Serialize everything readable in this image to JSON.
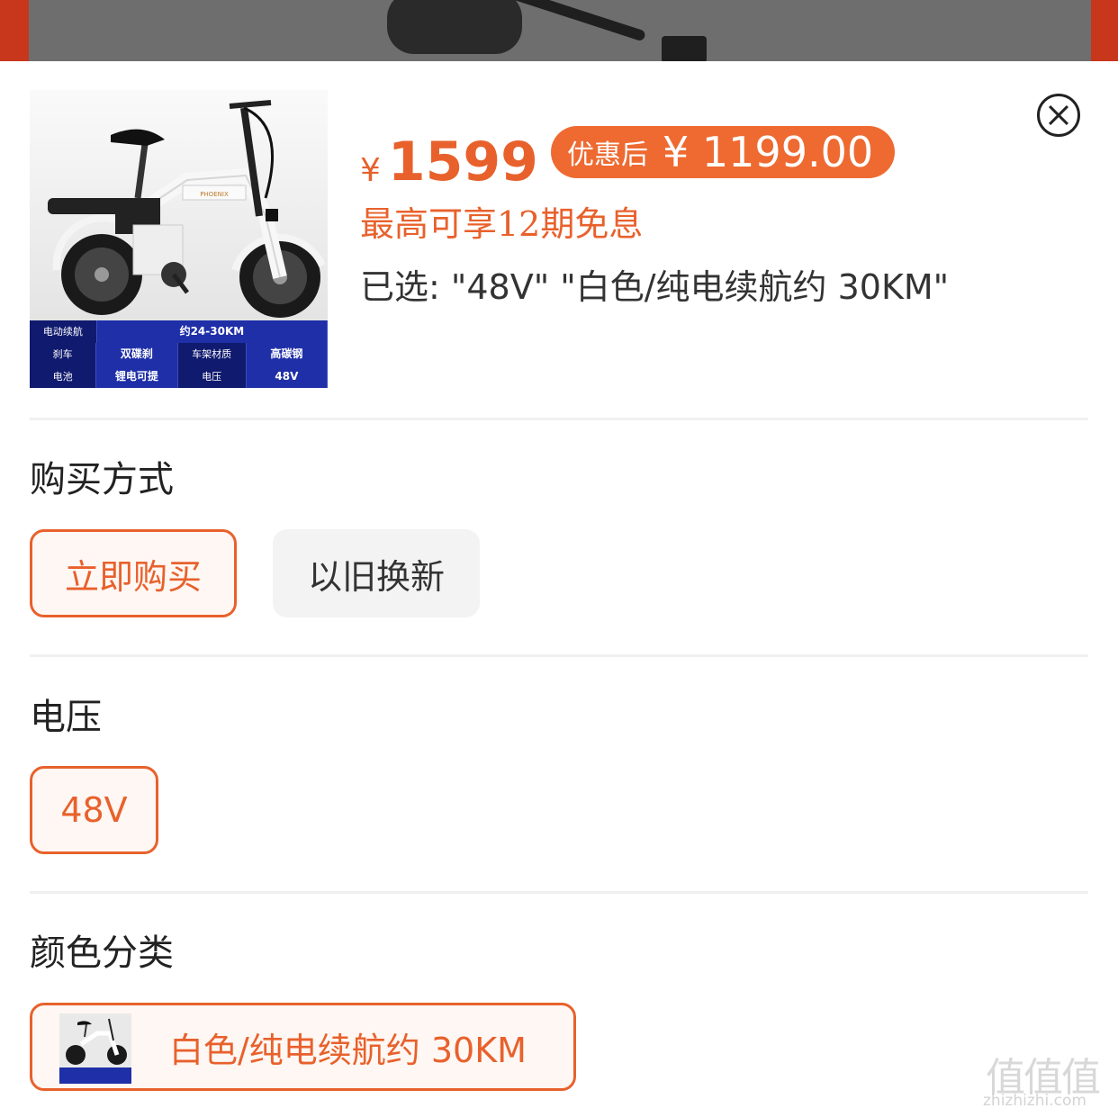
{
  "header": {
    "currency": "¥",
    "price": "1599",
    "coupon_label": "优惠后",
    "coupon_price": "¥ 1199.00",
    "installment": "最高可享12期免息",
    "selected": "已选: \"48V\" \"白色/纯电续航约 30KM\"",
    "product_image": {
      "brand": "PHOENIX",
      "specs": {
        "range_label": "电动续航",
        "range_value": "约24-30KM",
        "brake_label": "刹车",
        "brake_value": "双碟刹",
        "frame_label": "车架材质",
        "frame_value": "高碳钢",
        "battery_label": "电池",
        "battery_value": "锂电可提",
        "voltage_label": "电压",
        "voltage_value": "48V"
      }
    }
  },
  "sections": {
    "purchase": {
      "title": "购买方式",
      "options": [
        "立即购买",
        "以旧换新"
      ],
      "selected": "立即购买"
    },
    "voltage": {
      "title": "电压",
      "options": [
        "48V"
      ],
      "selected": "48V"
    },
    "color": {
      "title": "颜色分类",
      "options": [
        "白色/纯电续航约 30KM"
      ],
      "selected": "白色/纯电续航约 30KM"
    }
  },
  "watermark": {
    "logo": "值值值",
    "site": "zhizhizhi.com"
  },
  "colors": {
    "accent": "#e8612c",
    "coupon_bg": "#ee6a31",
    "spec_blue": "#1f2fa8"
  }
}
